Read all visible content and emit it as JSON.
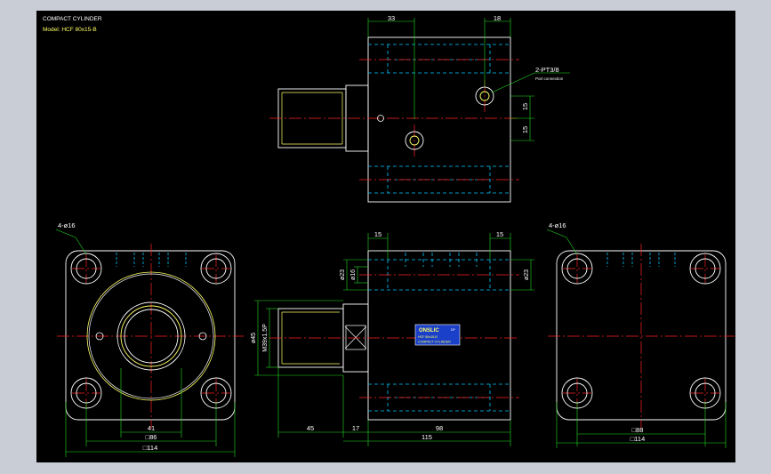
{
  "header": {
    "title": "COMPACT CYLINDER",
    "model": "Model: HCF 80x15-B"
  },
  "dimensions": {
    "top_view": {
      "d33": "33",
      "d18": "18",
      "port_label": "2-PT3/8",
      "port_sublabel": "Port connection",
      "d15a": "15",
      "d15b": "15"
    },
    "front_view": {
      "holes": "4-ø16",
      "d41": "41",
      "d86": "□86",
      "d114": "□114"
    },
    "side_view": {
      "d15l": "15",
      "d15r": "15",
      "phi23l": "ø23",
      "phi16": "ø16",
      "phi23r": "ø23",
      "phi45": "ø45",
      "thread": "M39x1.5P",
      "d45": "45",
      "d17": "17",
      "d98": "98",
      "d115": "115"
    },
    "back_view": {
      "holes": "4-ø16",
      "d88": "□88",
      "d114": "□114"
    }
  },
  "nameplate": {
    "brand": "ONSLIC",
    "brand_suffix": "DP",
    "line1": "HCF 80x15-B",
    "line2": "COMPACT CYLINDER"
  },
  "colors": {
    "window_bg": "#c9ced6",
    "canvas_bg": "#000000",
    "outline": "#ffffff",
    "hidden": "#00c8ff",
    "center": "#ff2222",
    "dimension": "#22dd22",
    "highlight": "#ffff66",
    "plate": "#1a3fc8"
  }
}
